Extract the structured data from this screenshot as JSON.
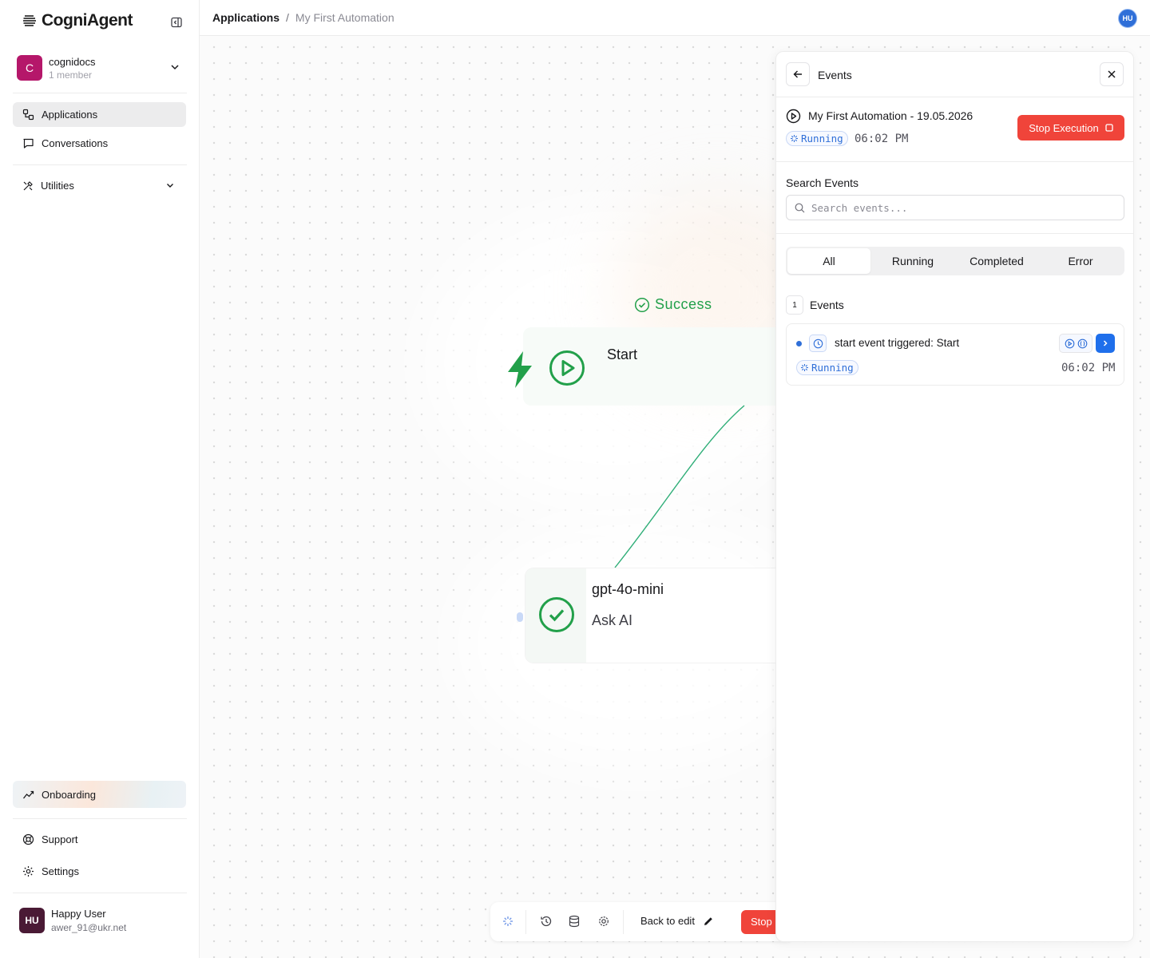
{
  "app": {
    "logo_text": "CogniAgent"
  },
  "org": {
    "initial": "C",
    "name": "cognidocs",
    "members": "1 member"
  },
  "sidebar": {
    "items": [
      {
        "label": "Applications",
        "icon": "applications-icon",
        "active": true
      },
      {
        "label": "Conversations",
        "icon": "chat-bubble-icon",
        "active": false
      }
    ],
    "utilities_label": "Utilities",
    "onboarding_label": "Onboarding",
    "support_label": "Support",
    "settings_label": "Settings"
  },
  "user": {
    "initials": "HU",
    "name": "Happy User",
    "email": "awer_91@ukr.net"
  },
  "breadcrumb": {
    "root": "Applications",
    "separator": "/",
    "current": "My First Automation"
  },
  "topbar": {
    "avatar_initials": "HU"
  },
  "canvas": {
    "success_label": "Success",
    "start_node": {
      "title": "Start"
    },
    "ai_node": {
      "model": "gpt-4o-mini",
      "description": "Ask AI"
    },
    "toolbar": {
      "back_to_edit": "Back to edit",
      "stop_label": "Stop"
    }
  },
  "events_panel": {
    "title": "Events",
    "execution_title": "My First Automation - 19.05.2026",
    "status": "Running",
    "time": "06:02 PM",
    "stop_button": "Stop Execution",
    "search_label": "Search Events",
    "search_placeholder": "Search events...",
    "tabs": [
      "All",
      "Running",
      "Completed",
      "Error"
    ],
    "active_tab": "All",
    "events_count": "1",
    "events_label": "Events",
    "events": [
      {
        "text": "start event triggered: Start",
        "status": "Running",
        "time": "06:02 PM"
      }
    ]
  },
  "colors": {
    "accent_blue": "#1f6feb",
    "success_green": "#22a04a",
    "danger_red": "#f0443a",
    "org_avatar": "#b5176a"
  }
}
